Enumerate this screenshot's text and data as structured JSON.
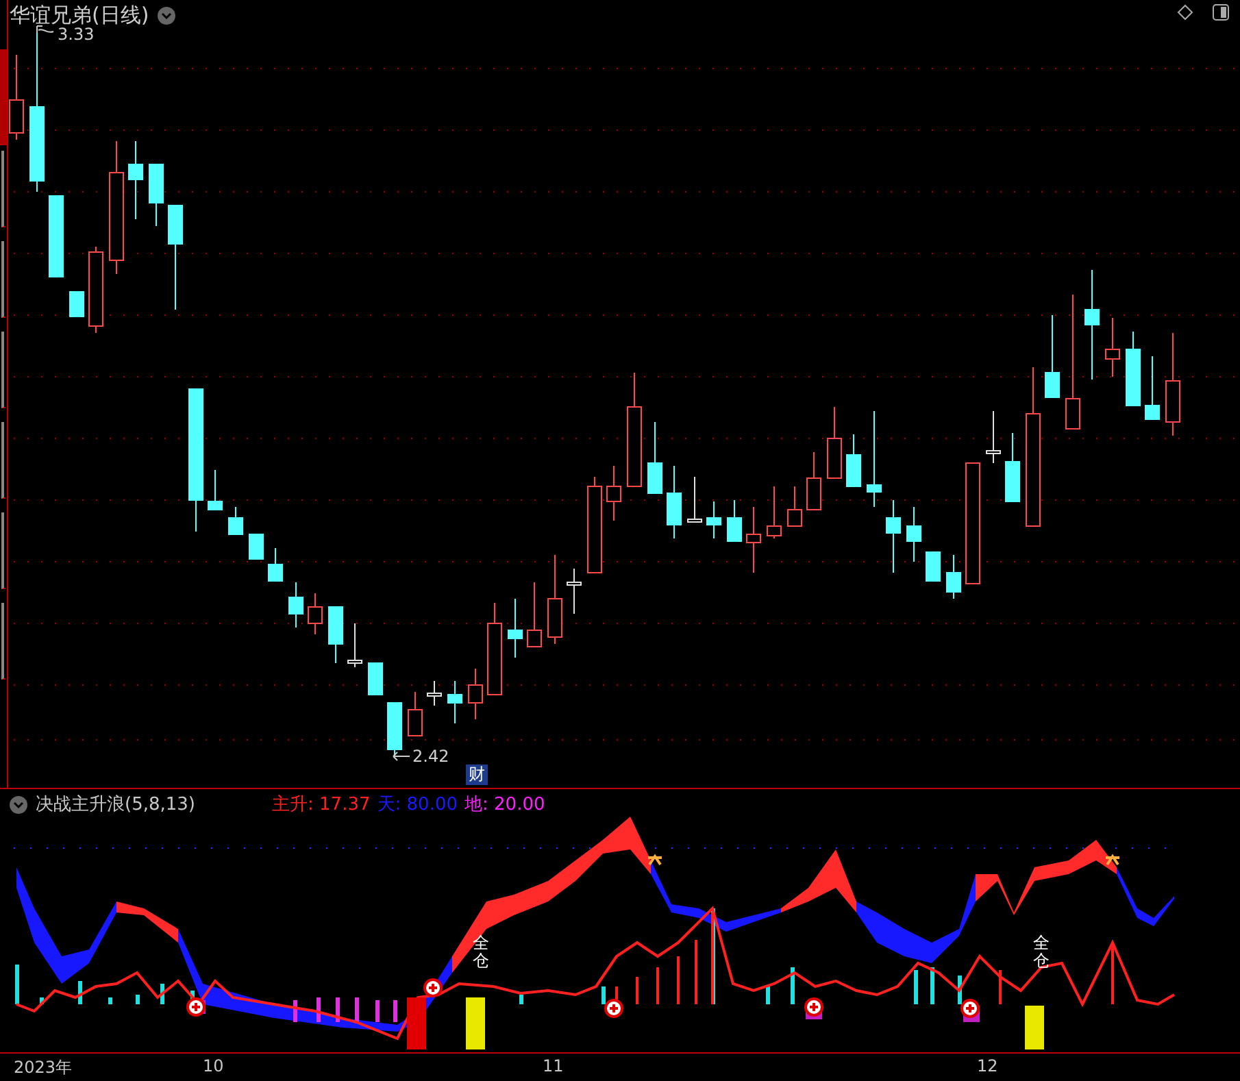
{
  "chart": {
    "title": "华谊兄弟(日线)",
    "high_label": "3.33",
    "low_label": "2.42",
    "badge": "财"
  },
  "sidebar": {
    "tabs": [
      {
        "selected": true
      },
      {
        "selected": false
      },
      {
        "selected": false
      },
      {
        "selected": false
      },
      {
        "selected": false
      },
      {
        "selected": false
      },
      {
        "selected": false
      }
    ]
  },
  "indicator": {
    "title": "决战主升浪(5,8,13)",
    "readings": [
      {
        "label": "主升:",
        "value": "17.37",
        "color": "#ff2020"
      },
      {
        "label": "天:",
        "value": "80.00",
        "color": "#1a1aff"
      },
      {
        "label": "地:",
        "value": "20.00",
        "color": "#ff20ff"
      }
    ],
    "signals": [
      "全仓",
      "全仓"
    ]
  },
  "axis": {
    "labels": [
      "2023年",
      "10",
      "11",
      "12"
    ]
  }
}
